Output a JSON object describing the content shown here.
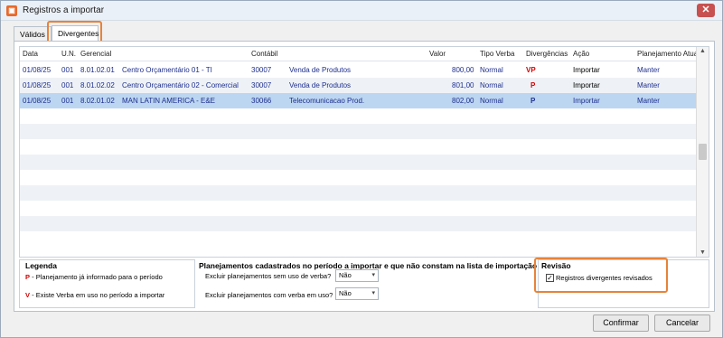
{
  "window": {
    "title": "Registros a importar",
    "close": "✕"
  },
  "tabs": [
    {
      "label": "Válidos"
    },
    {
      "label": "Divergentes"
    }
  ],
  "grid": {
    "headers": [
      "Data",
      "U.N.",
      "Gerencial",
      "Contábil",
      "Valor",
      "Tipo Verba",
      "Divergências",
      "Ação",
      "Planejamento Atual"
    ],
    "rows": [
      {
        "data": "01/08/25",
        "un": "001",
        "ger_code": "8.01.02.01",
        "ger_name": "Centro Orçamentário 01 - TI",
        "cont_code": "30007",
        "cont_name": "Venda de Produtos",
        "valor": "800,00",
        "tipo": "Normal",
        "div": "VP",
        "acao": "Importar",
        "plan": "Manter"
      },
      {
        "data": "01/08/25",
        "un": "001",
        "ger_code": "8.01.02.02",
        "ger_name": "Centro Orçamentário 02 - Comercial",
        "cont_code": "30007",
        "cont_name": "Venda de Produtos",
        "valor": "801,00",
        "tipo": "Normal",
        "div": "P",
        "acao": "Importar",
        "plan": "Manter"
      },
      {
        "data": "01/08/25",
        "un": "001",
        "ger_code": "8.02.01.02",
        "ger_name": "MAN LATIN AMERICA - E&E",
        "cont_code": "30066",
        "cont_name": "Telecomunicacao Prod.",
        "valor": "802,00",
        "tipo": "Normal",
        "div": "P",
        "acao": "Importar",
        "plan": "Manter"
      }
    ]
  },
  "legend": {
    "title": "Legenda",
    "p_letter": "P",
    "p_text": "- Planejamento já informado para o período",
    "v_letter": "V",
    "v_text": "- Existe Verba em uso no período a importar"
  },
  "planejamentos": {
    "title": "Planejamentos cadastrados no período a importar e que não constam na lista de importação",
    "excluir_sem_label": "Excluir planejamentos sem uso de verba?",
    "excluir_sem_value": "Não",
    "excluir_com_label": "Excluir planejamentos com verba em uso?",
    "excluir_com_value": "Não"
  },
  "revisao": {
    "title": "Revisão",
    "checkbox_label": "Registros divergentes revisados",
    "checked_mark": "✓"
  },
  "buttons": {
    "confirmar": "Confirmar",
    "cancelar": "Cancelar"
  },
  "colors": {
    "highlight": "#e7833a",
    "selected_row": "#bcd6f1",
    "link_text": "#1e2f8f",
    "divergence_red": "#d40000"
  }
}
